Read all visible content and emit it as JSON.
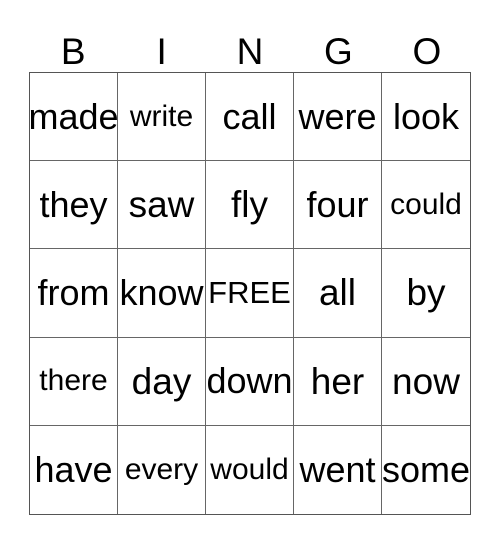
{
  "card": {
    "type": "bingo-card",
    "header_letters": [
      "B",
      "I",
      "N",
      "G",
      "O"
    ],
    "grid_size": "5x5",
    "free_space": "FREE",
    "free_space_position": {
      "row": 3,
      "column": 3
    },
    "colors": {
      "background": "#ffffff",
      "text": "#000000",
      "grid_line": "#666666",
      "grid_border": "#555555"
    },
    "rows": [
      {
        "cells": [
          {
            "text": "made"
          },
          {
            "text": "write"
          },
          {
            "text": "call"
          },
          {
            "text": "were"
          },
          {
            "text": "look"
          }
        ]
      },
      {
        "cells": [
          {
            "text": "they"
          },
          {
            "text": "saw"
          },
          {
            "text": "fly"
          },
          {
            "text": "four"
          },
          {
            "text": "could"
          }
        ]
      },
      {
        "cells": [
          {
            "text": "from"
          },
          {
            "text": "know"
          },
          {
            "text": "FREE"
          },
          {
            "text": "all"
          },
          {
            "text": "by"
          }
        ]
      },
      {
        "cells": [
          {
            "text": "there"
          },
          {
            "text": "day"
          },
          {
            "text": "down"
          },
          {
            "text": "her"
          },
          {
            "text": "now"
          }
        ]
      },
      {
        "cells": [
          {
            "text": "have"
          },
          {
            "text": "every"
          },
          {
            "text": "would"
          },
          {
            "text": "went"
          },
          {
            "text": "some"
          }
        ]
      }
    ]
  }
}
